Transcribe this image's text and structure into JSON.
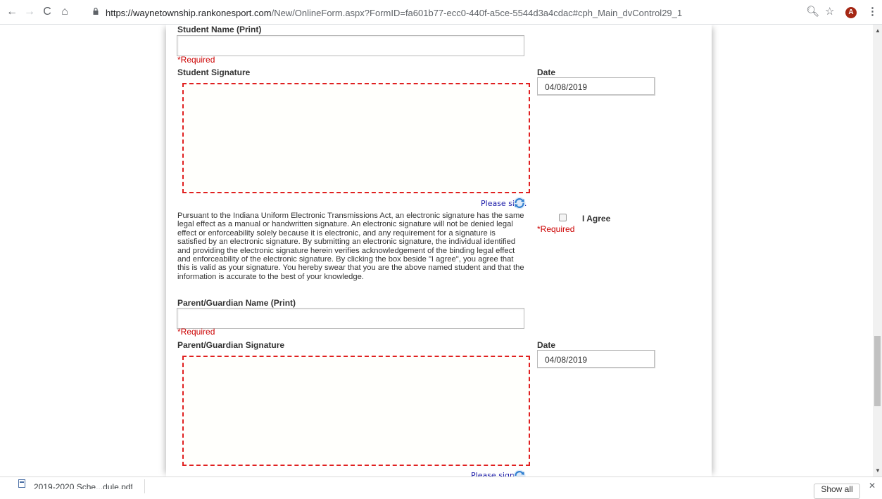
{
  "browser": {
    "url_host": "https://waynetownship.rankonesport.com",
    "url_path": "/New/OnlineForm.aspx?FormID=fa601b77-ecc0-440f-a5ce-5544d3a4cdac#cph_Main_dvControl29_1",
    "avatar_letter": "A"
  },
  "form": {
    "student_name_label": "Student Name (Print)",
    "student_name_value": "",
    "required_text": "*Required",
    "student_signature_label": "Student Signature",
    "date_label": "Date",
    "student_date_value": "04/08/2019",
    "please_sign": "Please sign.",
    "legal_text": "Pursuant to the Indiana Uniform Electronic Transmissions Act, an electronic signature has the same legal effect as a manual or handwritten signature. An electronic signature will not be denied legal effect or enforceability solely because it is electronic, and any requirement for a signature is satisfied by an electronic signature. By submitting an electronic signature, the individual identified and providing the electronic signature herein verifies acknowledgement of the binding legal effect and enforceability of the electronic signature. By clicking the box beside \"I agree\", you agree that this is valid as your signature. You hereby swear that you are the above named student and that the information is accurate to the best of your knowledge.",
    "agree_label": "I Agree",
    "agree_checked": false,
    "parent_name_label": "Parent/Guardian Name (Print)",
    "parent_name_value": "",
    "parent_signature_label": "Parent/Guardian Signature",
    "parent_date_value": "04/08/2019",
    "please_sign_2": "Please sign."
  },
  "downloads": {
    "item_name": "2019-2020 Sche...dule.pdf",
    "show_all": "Show all"
  },
  "colors": {
    "required": "#cc0000",
    "sig_border": "#e02020",
    "please_sign": "#1a1aa8"
  }
}
